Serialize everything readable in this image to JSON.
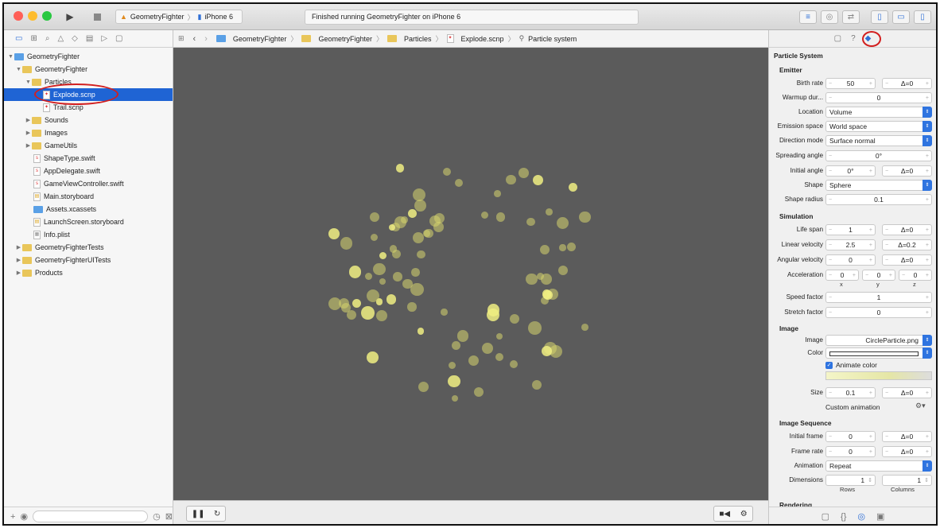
{
  "toolbar": {
    "scheme_project": "GeometryFighter",
    "scheme_device": "iPhone 6",
    "status_text": "Finished running GeometryFighter on iPhone 6",
    "window_buttons": {
      "close": "#ff5f57",
      "minimize": "#febc2e",
      "zoom": "#28c840"
    }
  },
  "navigator": {
    "items": [
      {
        "label": "GeometryFighter",
        "kind": "project"
      },
      {
        "label": "GeometryFighter",
        "kind": "folder"
      },
      {
        "label": "Particles",
        "kind": "folder"
      },
      {
        "label": "Explode.scnp",
        "kind": "file",
        "selected": true
      },
      {
        "label": "Trail.scnp",
        "kind": "file"
      },
      {
        "label": "Sounds",
        "kind": "folder"
      },
      {
        "label": "Images",
        "kind": "folder"
      },
      {
        "label": "GameUtils",
        "kind": "folder"
      },
      {
        "label": "ShapeType.swift",
        "kind": "file"
      },
      {
        "label": "AppDelegate.swift",
        "kind": "file"
      },
      {
        "label": "GameViewController.swift",
        "kind": "file"
      },
      {
        "label": "Main.storyboard",
        "kind": "file"
      },
      {
        "label": "Assets.xcassets",
        "kind": "folder"
      },
      {
        "label": "LaunchScreen.storyboard",
        "kind": "file"
      },
      {
        "label": "Info.plist",
        "kind": "file"
      },
      {
        "label": "GeometryFighterTests",
        "kind": "folder"
      },
      {
        "label": "GeometryFighterUITests",
        "kind": "folder"
      },
      {
        "label": "Products",
        "kind": "folder"
      }
    ]
  },
  "jumpbar": {
    "crumbs": [
      "GeometryFighter",
      "GeometryFighter",
      "Particles",
      "Explode.scnp",
      "Particle system"
    ]
  },
  "inspector": {
    "title": "Particle System",
    "sections": {
      "emitter": "Emitter",
      "simulation": "Simulation",
      "image": "Image",
      "image_sequence": "Image Sequence",
      "rendering": "Rendering"
    },
    "emitter": {
      "birth_rate_label": "Birth rate",
      "birth_rate": "50",
      "birth_rate_var": "Δ=0",
      "warmup_label": "Warmup dur...",
      "warmup": "0",
      "location_label": "Location",
      "location": "Volume",
      "emission_space_label": "Emission space",
      "emission_space": "World space",
      "direction_mode_label": "Direction mode",
      "direction_mode": "Surface normal",
      "spreading_angle_label": "Spreading angle",
      "spreading_angle": "0°",
      "initial_angle_label": "Initial angle",
      "initial_angle": "0°",
      "initial_angle_var": "Δ=0",
      "shape_label": "Shape",
      "shape": "Sphere",
      "shape_radius_label": "Shape radius",
      "shape_radius": "0.1"
    },
    "simulation": {
      "life_span_label": "Life span",
      "life_span": "1",
      "life_span_var": "Δ=0",
      "linear_velocity_label": "Linear velocity",
      "linear_velocity": "2.5",
      "linear_velocity_var": "Δ=0.2",
      "angular_velocity_label": "Angular velocity",
      "angular_velocity": "0",
      "angular_velocity_var": "Δ=0",
      "acceleration_label": "Acceleration",
      "acc_x": "0",
      "acc_y": "0",
      "acc_z": "0",
      "x_label": "x",
      "y_label": "y",
      "z_label": "z",
      "speed_factor_label": "Speed factor",
      "speed_factor": "1",
      "stretch_factor_label": "Stretch factor",
      "stretch_factor": "0"
    },
    "image": {
      "image_label": "Image",
      "image": "CircleParticle.png",
      "color_label": "Color",
      "animate_color_label": "Animate color",
      "size_label": "Size",
      "size": "0.1",
      "size_var": "Δ=0",
      "custom_animation_label": "Custom animation"
    },
    "image_sequence": {
      "initial_frame_label": "Initial frame",
      "initial_frame": "0",
      "initial_frame_var": "Δ=0",
      "frame_rate_label": "Frame rate",
      "frame_rate": "0",
      "frame_rate_var": "Δ=0",
      "animation_label": "Animation",
      "animation": "Repeat",
      "dimensions_label": "Dimensions",
      "rows": "1",
      "columns": "1",
      "rows_label": "Rows",
      "columns_label": "Columns"
    }
  },
  "colors": {
    "accent": "#1f64d4",
    "viewport_bg": "#5b5b5b",
    "particle": "#d6d36e",
    "highlight": "#d21f1f"
  }
}
